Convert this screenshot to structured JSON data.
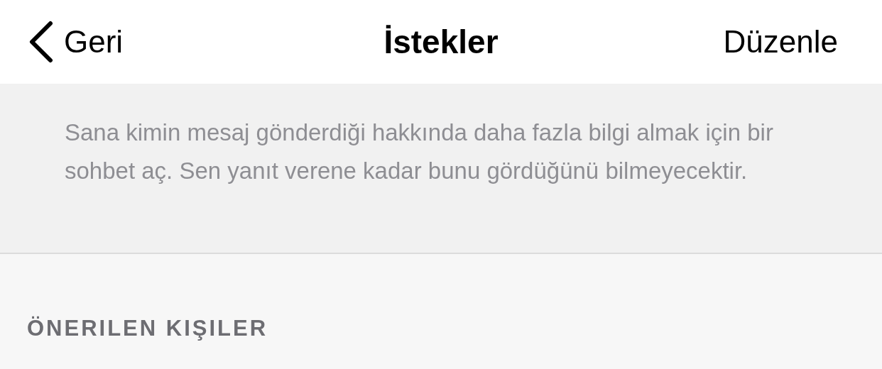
{
  "nav_bar": {
    "back_label": "Geri",
    "title": "İstekler",
    "edit_label": "Düzenle"
  },
  "info_text": "Sana kimin mesaj gönderdiği hakkında daha fazla bilgi almak için bir sohbet aç. Sen yanıt verene kadar bunu gördüğünü bilmeyecektir.",
  "section_header": "ÖNERILEN KIŞILER"
}
